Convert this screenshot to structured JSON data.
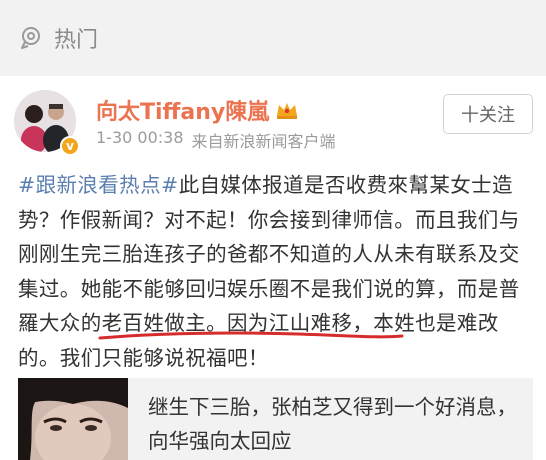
{
  "hot_section": {
    "icon": "hot-pin-icon",
    "label": "热门"
  },
  "post": {
    "username": "向太Tiffany陳嵐",
    "badge_icon": "crown-icon",
    "verified_icon": "verified-v-icon",
    "time": "1-30 00:38",
    "source": "来自新浪新闻客户端",
    "follow_label": "十关注",
    "hashtag": "#跟新浪看热点#",
    "text_part1": "此自媒体报道是否收费來幫某女士造势？作假新闻？对不起！你会接到律师信。而且我们与刚刚",
    "text_underlined": "生完三胎连孩子的爸都不知道的人",
    "text_part2": "从未有联系及交集过。她能不能够回归娱乐圈不是我们说的算，而是普羅大众的老百姓做主。因为江山难移，本姓也是难改的。我们只能够说祝福吧！",
    "accent_color": "#eb7350",
    "hashtag_color": "#5b7fb0",
    "underline_color": "#d62c2c"
  },
  "news_card": {
    "title": "继生下三胎，张柏芝又得到一个好消息，向华强向太回应"
  }
}
